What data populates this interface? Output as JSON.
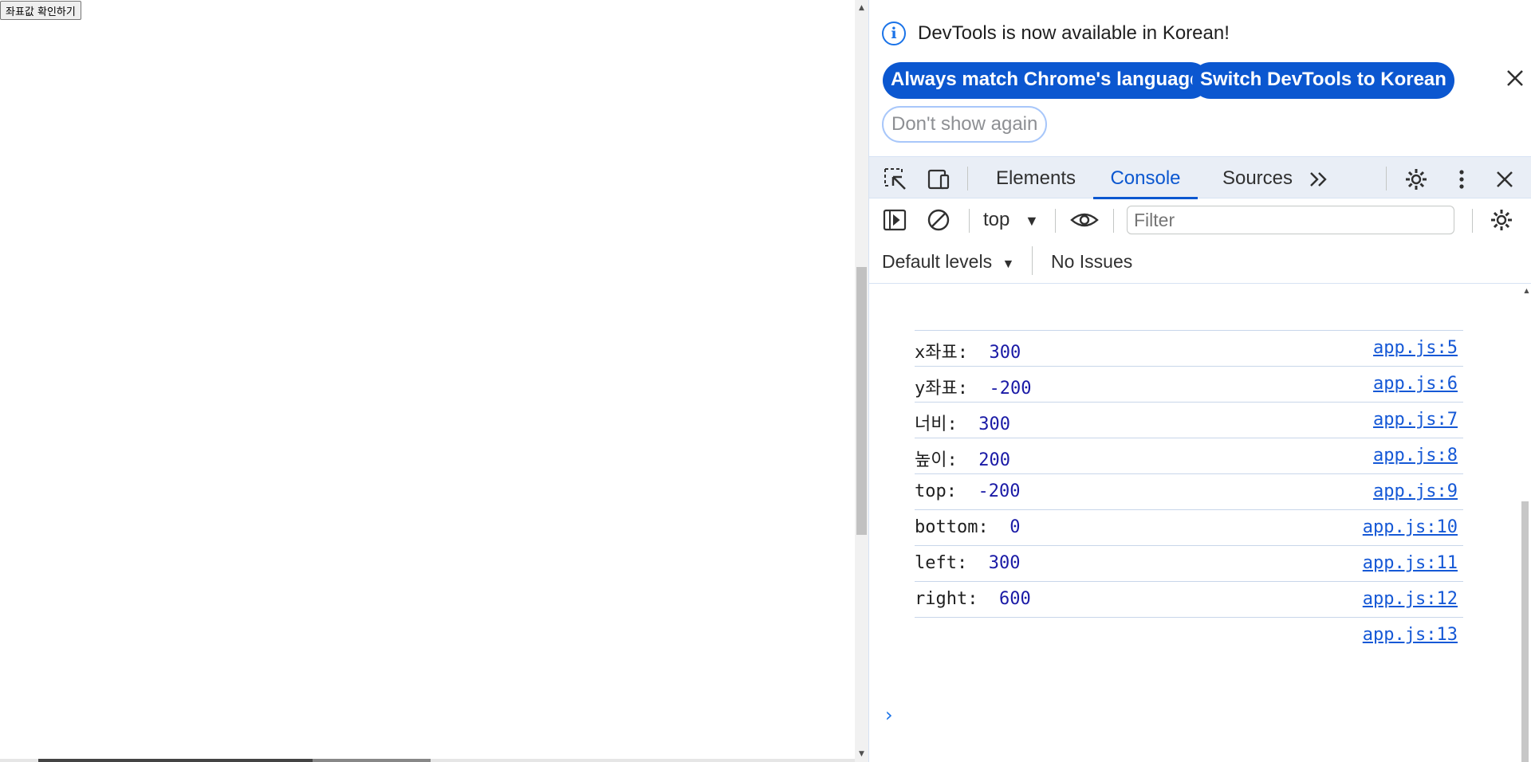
{
  "page": {
    "button_label": "좌표값 확인하기"
  },
  "infobar": {
    "message": "DevTools is now available in Korean!",
    "match_language_label": "Always match Chrome's language",
    "switch_label": "Switch DevTools to Korean",
    "dont_show_label": "Don't show again"
  },
  "tabs": {
    "elements": "Elements",
    "console": "Console",
    "sources": "Sources"
  },
  "console_toolbar": {
    "context": "top",
    "filter_placeholder": "Filter",
    "levels": "Default levels",
    "issues": "No Issues"
  },
  "logs": [
    {
      "label": "x좌표:  ",
      "value": "300",
      "source": "app.js:5"
    },
    {
      "label": "y좌표:  ",
      "value": "-200",
      "source": "app.js:6"
    },
    {
      "label": "너비:  ",
      "value": "300",
      "source": "app.js:7"
    },
    {
      "label": "높이:  ",
      "value": "200",
      "source": "app.js:8"
    },
    {
      "label": "top:  ",
      "value": "-200",
      "source": "app.js:9"
    },
    {
      "label": "bottom:  ",
      "value": "0",
      "source": "app.js:10"
    },
    {
      "label": "left:  ",
      "value": "300",
      "source": "app.js:11"
    },
    {
      "label": "right:  ",
      "value": "600",
      "source": "app.js:12"
    },
    {
      "label": "",
      "value": "",
      "source": "app.js:13"
    }
  ],
  "colors": {
    "accent": "#0b57d0",
    "link": "#1558d6",
    "number": "#1a1aa6",
    "toolbar_bg": "#e9eef6"
  }
}
